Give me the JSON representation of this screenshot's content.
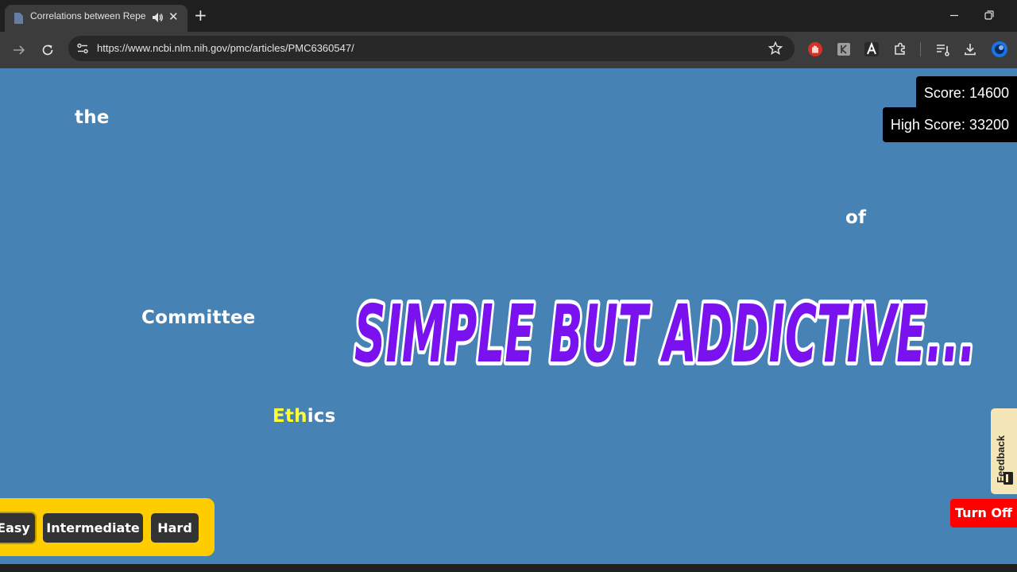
{
  "browser": {
    "tab_title": "Correlations between Repeat",
    "url": "https://www.ncbi.nlm.nih.gov/pmc/articles/PMC6360547/",
    "new_tab_symbol": "+",
    "close_symbol": "✕"
  },
  "game": {
    "words": [
      {
        "typed": "",
        "rest": "the"
      },
      {
        "typed": "",
        "rest": "of"
      },
      {
        "typed": "",
        "rest": "Committee"
      },
      {
        "typed": "Eth",
        "rest": "ics"
      }
    ],
    "score_label": "Score: 14600",
    "high_score_label": "High Score: 33200",
    "banner_text": "SIMPLE BUT ADDICTIVE...",
    "difficulty": {
      "options": [
        "Easy",
        "Intermediate",
        "Hard"
      ],
      "selected": "Easy"
    },
    "feedback_label": "Feedback",
    "turn_off_label": "Turn Off"
  },
  "colors": {
    "background": "#4682b4",
    "word": "#ffffff",
    "typed_letters": "#ffff33",
    "banner_fill": "#7a12f0",
    "panel": "#ffcc00",
    "turn_off": "#ff0000"
  }
}
